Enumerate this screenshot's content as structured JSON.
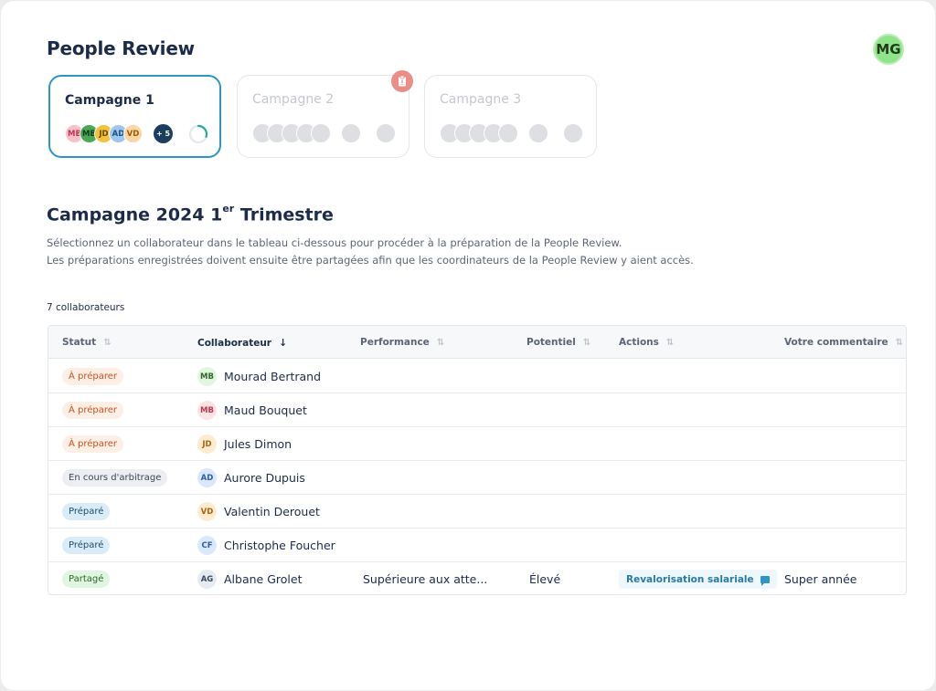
{
  "header": {
    "title": "People Review",
    "user_initials": "MG"
  },
  "campaigns": [
    {
      "title": "Campagne 1",
      "active": true,
      "avatars": [
        {
          "initials": "MB",
          "bg": "#f6c1c9",
          "fg": "#c2354e"
        },
        {
          "initials": "MB",
          "bg": "#49a858",
          "fg": "#0f3d18"
        },
        {
          "initials": "JD",
          "bg": "#f3c23c",
          "fg": "#6b4a00"
        },
        {
          "initials": "AD",
          "bg": "#9fc6ee",
          "fg": "#1e4f87"
        },
        {
          "initials": "VD",
          "bg": "#fbd6a4",
          "fg": "#9a5a08"
        }
      ],
      "extra_count": "+ 5",
      "progress": 0.3
    },
    {
      "title": "Campagne 2",
      "active": false,
      "alert": true
    },
    {
      "title": "Campagne 3",
      "active": false
    }
  ],
  "section": {
    "title_main": "Campagne 2024 1",
    "title_sup": "er",
    "title_rest": " Trimestre",
    "desc_line1": "Sélectionnez un collaborateur dans le tableau ci-dessous pour procéder à la préparation de la People Review.",
    "desc_line2": "Les préparations enregistrées doivent ensuite être partagées afin que les coordinateurs de la People Review y aient accès."
  },
  "table": {
    "count_label": "7 collaborateurs",
    "columns": [
      "Statut",
      "Collaborateur",
      "Performance",
      "Potentiel",
      "Actions",
      "Votre commentaire"
    ],
    "rows": [
      {
        "status": "À préparer",
        "status_bg": "#fdeee6",
        "status_fg": "#c8541e",
        "initials": "MB",
        "av_bg": "#e2f5de",
        "av_fg": "#2d6a2a",
        "name": "Mourad Bertrand",
        "performance": "",
        "potential": "",
        "action": "",
        "comment": ""
      },
      {
        "status": "À préparer",
        "status_bg": "#fdeee6",
        "status_fg": "#c8541e",
        "initials": "MB",
        "av_bg": "#fbe3e6",
        "av_fg": "#c2354e",
        "name": "Maud Bouquet",
        "performance": "",
        "potential": "",
        "action": "",
        "comment": ""
      },
      {
        "status": "À préparer",
        "status_bg": "#fdeee6",
        "status_fg": "#c8541e",
        "initials": "JD",
        "av_bg": "#fdecd2",
        "av_fg": "#b0610b",
        "name": "Jules Dimon",
        "performance": "",
        "potential": "",
        "action": "",
        "comment": ""
      },
      {
        "status": "En cours d'arbitrage",
        "status_bg": "#eceef1",
        "status_fg": "#3d4656",
        "initials": "AD",
        "av_bg": "#dbe8fb",
        "av_fg": "#2b5fa8",
        "name": "Aurore Dupuis",
        "performance": "",
        "potential": "",
        "action": "",
        "comment": ""
      },
      {
        "status": "Préparé",
        "status_bg": "#d9ecf7",
        "status_fg": "#1f4d6e",
        "initials": "VD",
        "av_bg": "#fdecd2",
        "av_fg": "#b0610b",
        "name": "Valentin Derouet",
        "performance": "",
        "potential": "",
        "action": "",
        "comment": ""
      },
      {
        "status": "Préparé",
        "status_bg": "#d9ecf7",
        "status_fg": "#1f4d6e",
        "initials": "CF",
        "av_bg": "#dbe8fb",
        "av_fg": "#2b5fa8",
        "name": "Christophe Foucher",
        "performance": "",
        "potential": "",
        "action": "",
        "comment": ""
      },
      {
        "status": "Partagé",
        "status_bg": "#e1f6e0",
        "status_fg": "#2b6a28",
        "initials": "AG",
        "av_bg": "#e6ebf1",
        "av_fg": "#3a4a60",
        "name": "Albane Grolet",
        "performance": "Supérieure aux atte...",
        "potential": "Élevé",
        "action": "Revalorisation salariale",
        "comment": "Super année"
      }
    ]
  }
}
